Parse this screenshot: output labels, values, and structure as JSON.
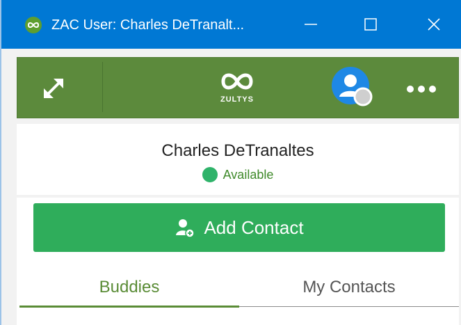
{
  "window": {
    "title": "ZAC User: Charles DeTranalt...",
    "app_icon": "zultys-app-icon",
    "controls": {
      "minimize_icon": "minimize-icon",
      "maximize_icon": "maximize-icon",
      "close_icon": "close-icon"
    }
  },
  "toolbar": {
    "expand_icon": "expand-arrows-icon",
    "logo_text": "ZULTYS",
    "avatar_icon": "user-avatar-icon",
    "more_icon": "more-horizontal-icon"
  },
  "user": {
    "name": "Charles DeTranaltes",
    "status": "Available",
    "status_color": "#2fb36a"
  },
  "actions": {
    "add_contact_label": "Add Contact",
    "add_contact_icon": "add-user-icon"
  },
  "tabs": [
    {
      "label": "Buddies",
      "active": true
    },
    {
      "label": "My Contacts",
      "active": false
    }
  ],
  "colors": {
    "titlebar": "#0078d4",
    "toolbar": "#5c8a3c",
    "accent_green": "#2fad5b",
    "tab_active": "#5a8c36"
  }
}
